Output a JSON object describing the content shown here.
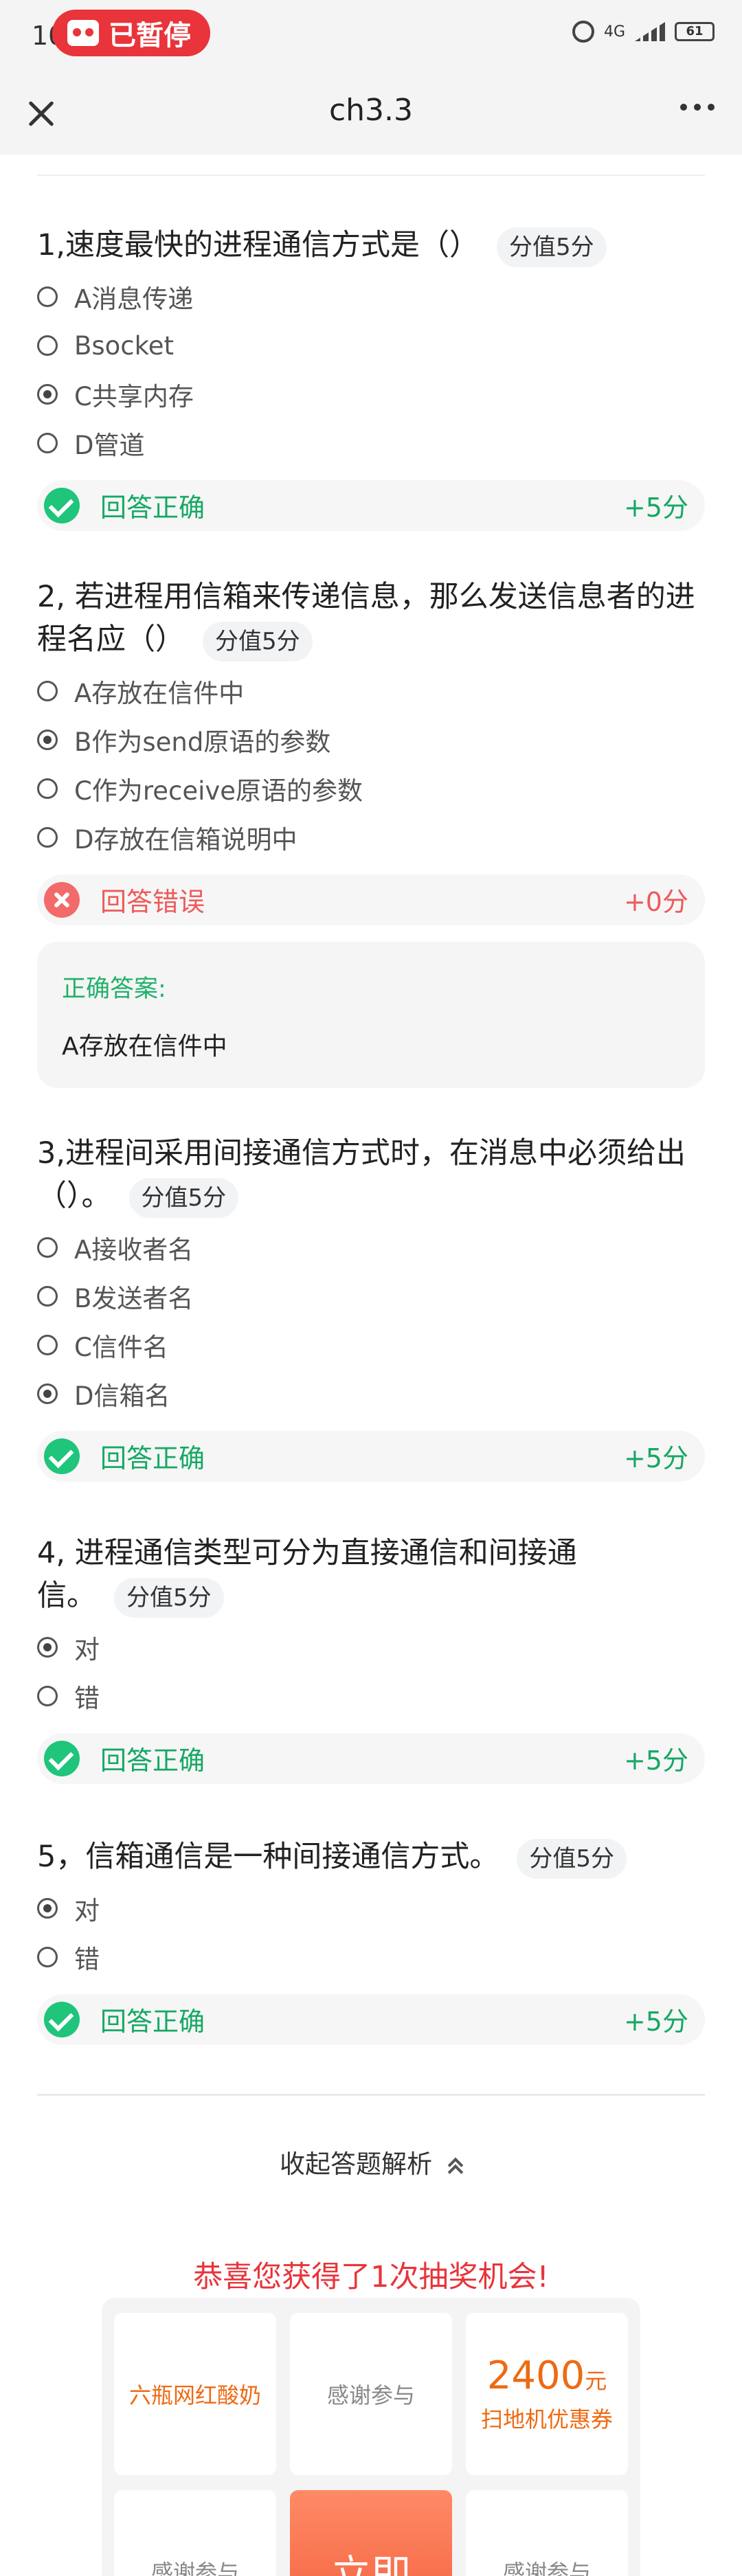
{
  "status_bar": {
    "time": "10",
    "recording_label": "已暂停",
    "network": "4G",
    "battery": "61"
  },
  "header": {
    "title": "ch3.3"
  },
  "questions": [
    {
      "title": "1,速度最快的进程通信方式是（）",
      "score": "分值5分",
      "options": [
        "A消息传递",
        "Bsocket",
        "C共享内存",
        "D管道"
      ],
      "selected_index": 2,
      "result": {
        "status": "correct",
        "text": "回答正确",
        "points": "+5分"
      }
    },
    {
      "title": "2, 若进程用信箱来传递信息，那么发送信息者的进程名应（）",
      "score": "分值5分",
      "options": [
        "A存放在信件中",
        "B作为send原语的参数",
        "C作为receive原语的参数",
        "D存放在信箱说明中"
      ],
      "selected_index": 1,
      "result": {
        "status": "wrong",
        "text": "回答错误",
        "points": "+0分"
      },
      "correct_answer": {
        "label": "正确答案:",
        "value": "A存放在信件中"
      }
    },
    {
      "title": "3,进程间采用间接通信方式时，在消息中必须给出（）。",
      "score": "分值5分",
      "options": [
        "A接收者名",
        "B发送者名",
        "C信件名",
        "D信箱名"
      ],
      "selected_index": 3,
      "result": {
        "status": "correct",
        "text": "回答正确",
        "points": "+5分"
      }
    },
    {
      "title": "4, 进程通信类型可分为直接通信和间接通信。",
      "score": "分值5分",
      "options": [
        "对",
        "错"
      ],
      "selected_index": 0,
      "result": {
        "status": "correct",
        "text": "回答正确",
        "points": "+5分"
      }
    },
    {
      "title": "5，信箱通信是一种间接通信方式。",
      "score": "分值5分",
      "options": [
        "对",
        "错"
      ],
      "selected_index": 0,
      "result": {
        "status": "correct",
        "text": "回答正确",
        "points": "+5分"
      }
    }
  ],
  "collapse_label": "收起答题解析",
  "lottery": {
    "title": "恭喜您获得了1次抽奖机会!",
    "prizes": {
      "p1": "六瓶网红酸奶",
      "p2": "感谢参与",
      "p3_num": "2400",
      "p3_unit": "元",
      "p3_desc": "扫地机优惠券",
      "p4": "感谢参与",
      "go": "立即",
      "p6": "感谢参与"
    }
  }
}
